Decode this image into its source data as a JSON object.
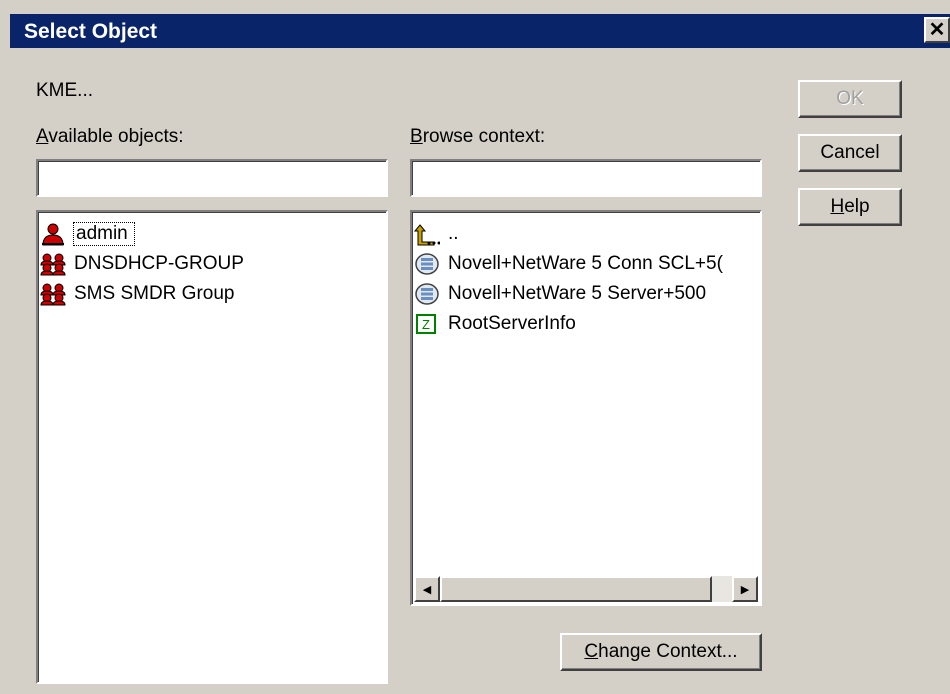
{
  "window": {
    "title": "Select Object",
    "close_glyph": "✕"
  },
  "context_path": "KME...",
  "available": {
    "label_accel": "A",
    "label_rest": "vailable objects:",
    "filter_value": "",
    "items": [
      {
        "label": "admin",
        "icon": "user-icon",
        "selected": true
      },
      {
        "label": "DNSDHCP-GROUP",
        "icon": "group-icon"
      },
      {
        "label": "SMS SMDR Group",
        "icon": "group-icon"
      }
    ]
  },
  "browse": {
    "label_accel": "B",
    "label_rest": "rowse context:",
    "filter_value": "",
    "items": [
      {
        "label": "..",
        "icon": "parent-container-icon"
      },
      {
        "label": "Novell+NetWare 5 Conn SCL+5(",
        "icon": "server-object-icon"
      },
      {
        "label": "Novell+NetWare 5 Server+500",
        "icon": "server-object-icon"
      },
      {
        "label": "RootServerInfo",
        "icon": "zone-object-icon"
      }
    ],
    "scroll_left_glyph": "◀",
    "scroll_right_glyph": "▶"
  },
  "buttons": {
    "ok": "OK",
    "cancel": "Cancel",
    "help_accel": "H",
    "help_rest": "elp",
    "change_accel": "C",
    "change_rest": "hange Context..."
  },
  "colors": {
    "titlebar": "#0a246a",
    "face": "#d4d0c8",
    "user_icon": "#cc0000",
    "parent_arrow": "#c8a000",
    "zone_icon": "#008000"
  }
}
